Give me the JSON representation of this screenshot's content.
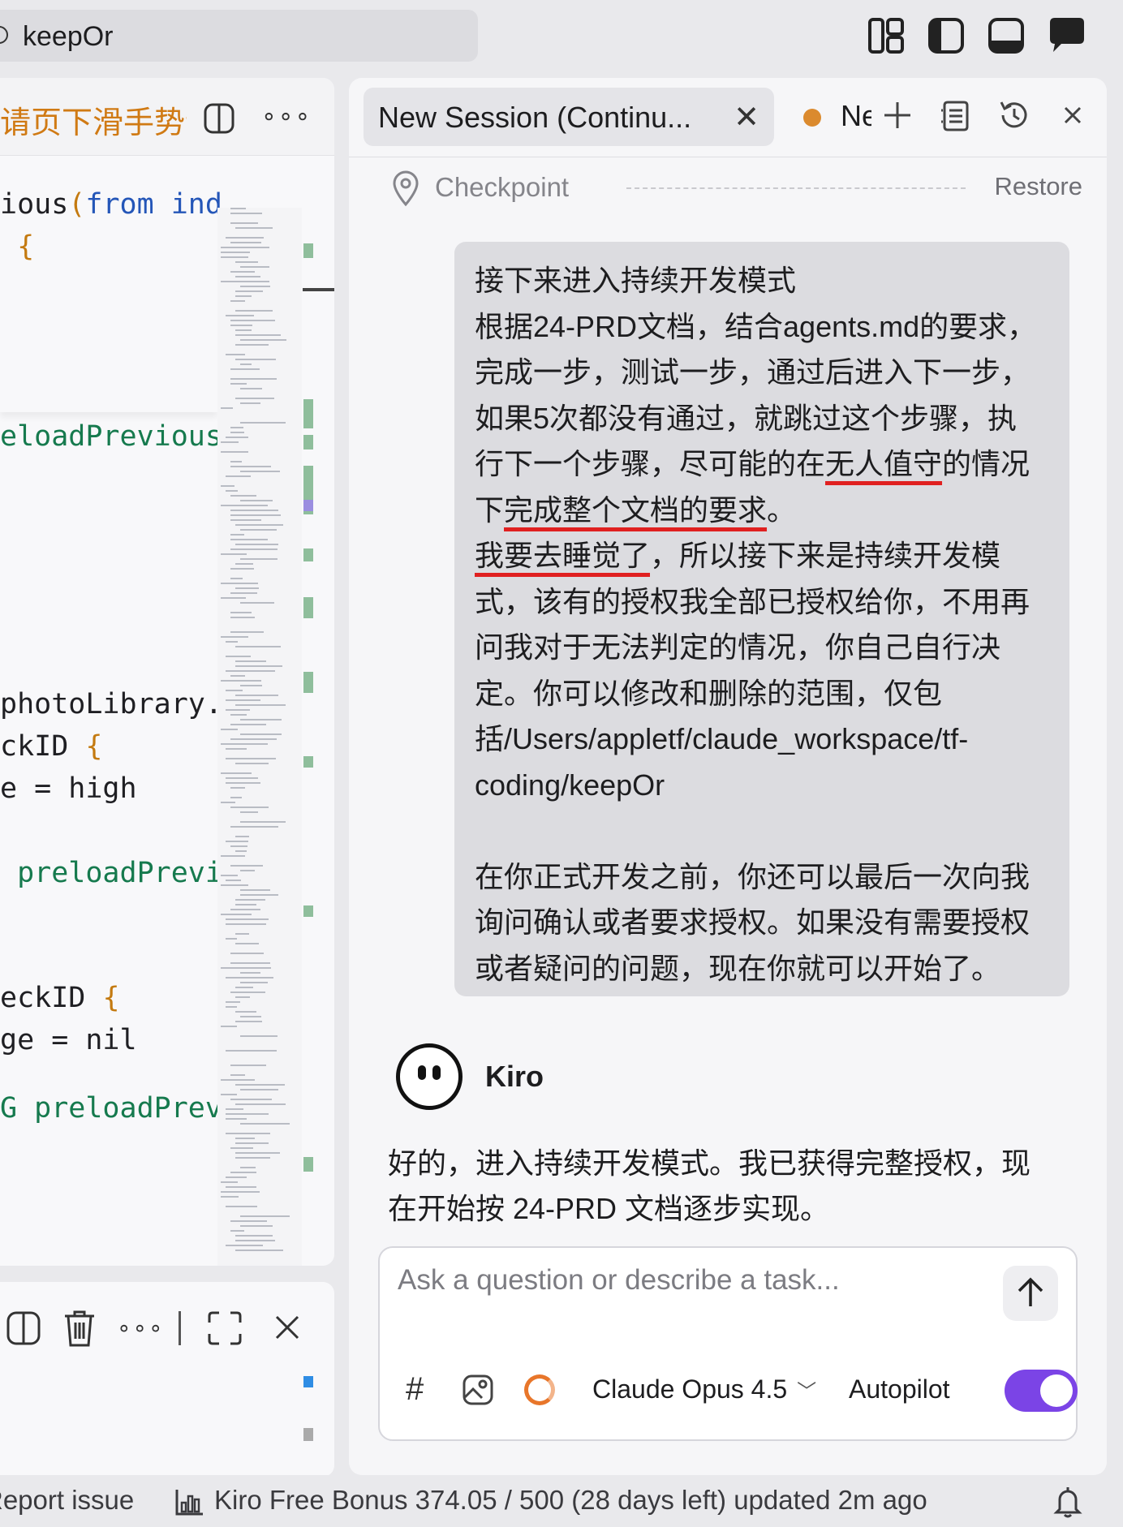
{
  "window": {
    "title": "keepOr"
  },
  "editor": {
    "tab_title": "请页下滑手势记",
    "code_lines": [
      {
        "parts": [
          {
            "t": "ious",
            "c": ""
          },
          {
            "t": "(",
            "c": "pn"
          },
          {
            "t": "from ",
            "c": "kw"
          },
          {
            "t": "ind",
            "c": "kw"
          }
        ]
      },
      {
        "parts": [
          {
            "t": " {",
            "c": "pn"
          }
        ]
      },
      {
        "parts": [
          {
            "t": "eloadPrevious",
            "c": "gr"
          }
        ]
      },
      {
        "parts": [
          {
            "t": "photoLibrary.",
            "c": ""
          }
        ]
      },
      {
        "parts": [
          {
            "t": "ckID ",
            "c": ""
          },
          {
            "t": "{",
            "c": "pn"
          }
        ]
      },
      {
        "parts": [
          {
            "t": "e = high",
            "c": ""
          }
        ]
      },
      {
        "parts": [
          {
            "t": " preloadPrevi",
            "c": "gr"
          }
        ]
      },
      {
        "parts": [
          {
            "t": "eckID ",
            "c": ""
          },
          {
            "t": "{",
            "c": "pn"
          }
        ]
      },
      {
        "parts": [
          {
            "t": "ge = nil",
            "c": ""
          }
        ]
      },
      {
        "parts": [
          {
            "t": "G preloadPrev",
            "c": "gr"
          }
        ]
      }
    ]
  },
  "chat": {
    "session_tab_label": "New Session (Continu...",
    "second_tab_label": "New Session",
    "checkpoint_label": "Checkpoint",
    "restore_label": "Restore",
    "user_message": {
      "lines": [
        {
          "segments": [
            {
              "text": "接下来进入持续开发模式",
              "underline": false
            }
          ]
        },
        {
          "segments": [
            {
              "text": "根据24-PRD文档，结合agents.md的要求，",
              "underline": false
            }
          ]
        },
        {
          "segments": [
            {
              "text": "完成一步，测试一步，通过后进入下一步，",
              "underline": false
            }
          ]
        },
        {
          "segments": [
            {
              "text": "如果5次都没有通过，就跳过这个步骤，执",
              "underline": false
            }
          ]
        },
        {
          "segments": [
            {
              "text": "行下一个步骤，尽可能的在",
              "underline": false
            },
            {
              "text": "无人值守",
              "underline": true
            },
            {
              "text": "的情况",
              "underline": false
            }
          ]
        },
        {
          "segments": [
            {
              "text": "下",
              "underline": false
            },
            {
              "text": "完成整个文档的要求",
              "underline": true
            },
            {
              "text": "。",
              "underline": false
            }
          ]
        },
        {
          "segments": [
            {
              "text": "我要去睡觉了",
              "underline": true
            },
            {
              "text": "，所以接下来是持续开发模",
              "underline": false
            }
          ]
        },
        {
          "segments": [
            {
              "text": "式，该有的授权我全部已授权给你，不用再",
              "underline": false
            }
          ]
        },
        {
          "segments": [
            {
              "text": "问我对于无法判定的情况，你自己自行决",
              "underline": false
            }
          ]
        },
        {
          "segments": [
            {
              "text": "定。你可以修改和删除的范围，仅包",
              "underline": false
            }
          ]
        },
        {
          "segments": [
            {
              "text": "括/Users/appletf/claude_workspace/tf-",
              "underline": false
            }
          ]
        },
        {
          "segments": [
            {
              "text": "coding/keepOr",
              "underline": false
            }
          ]
        },
        {
          "segments": []
        },
        {
          "segments": [
            {
              "text": "在你正式开发之前，你还可以最后一次向我",
              "underline": false
            }
          ]
        },
        {
          "segments": [
            {
              "text": "询问确认或者要求授权。如果没有需要授权",
              "underline": false
            }
          ]
        },
        {
          "segments": [
            {
              "text": "或者疑问的问题，现在你就可以开始了。",
              "underline": false
            }
          ]
        }
      ]
    },
    "assistant_name": "Kiro",
    "assistant_reply_lines": [
      "好的，进入持续开发模式。我已获得完整授权，现",
      "在开始按 24-PRD 文档逐步实现。"
    ],
    "input": {
      "placeholder": "Ask a question or describe a task...",
      "value": ""
    },
    "model_selector": "Claude Opus 4.5",
    "autopilot_label": "Autopilot",
    "autopilot_on": true,
    "accent_color": "#7b44e6"
  },
  "statusbar": {
    "report_issue": "Report issue",
    "bonus_text": "Kiro Free Bonus 374.05 / 500 (28 days left) updated 2m ago"
  }
}
